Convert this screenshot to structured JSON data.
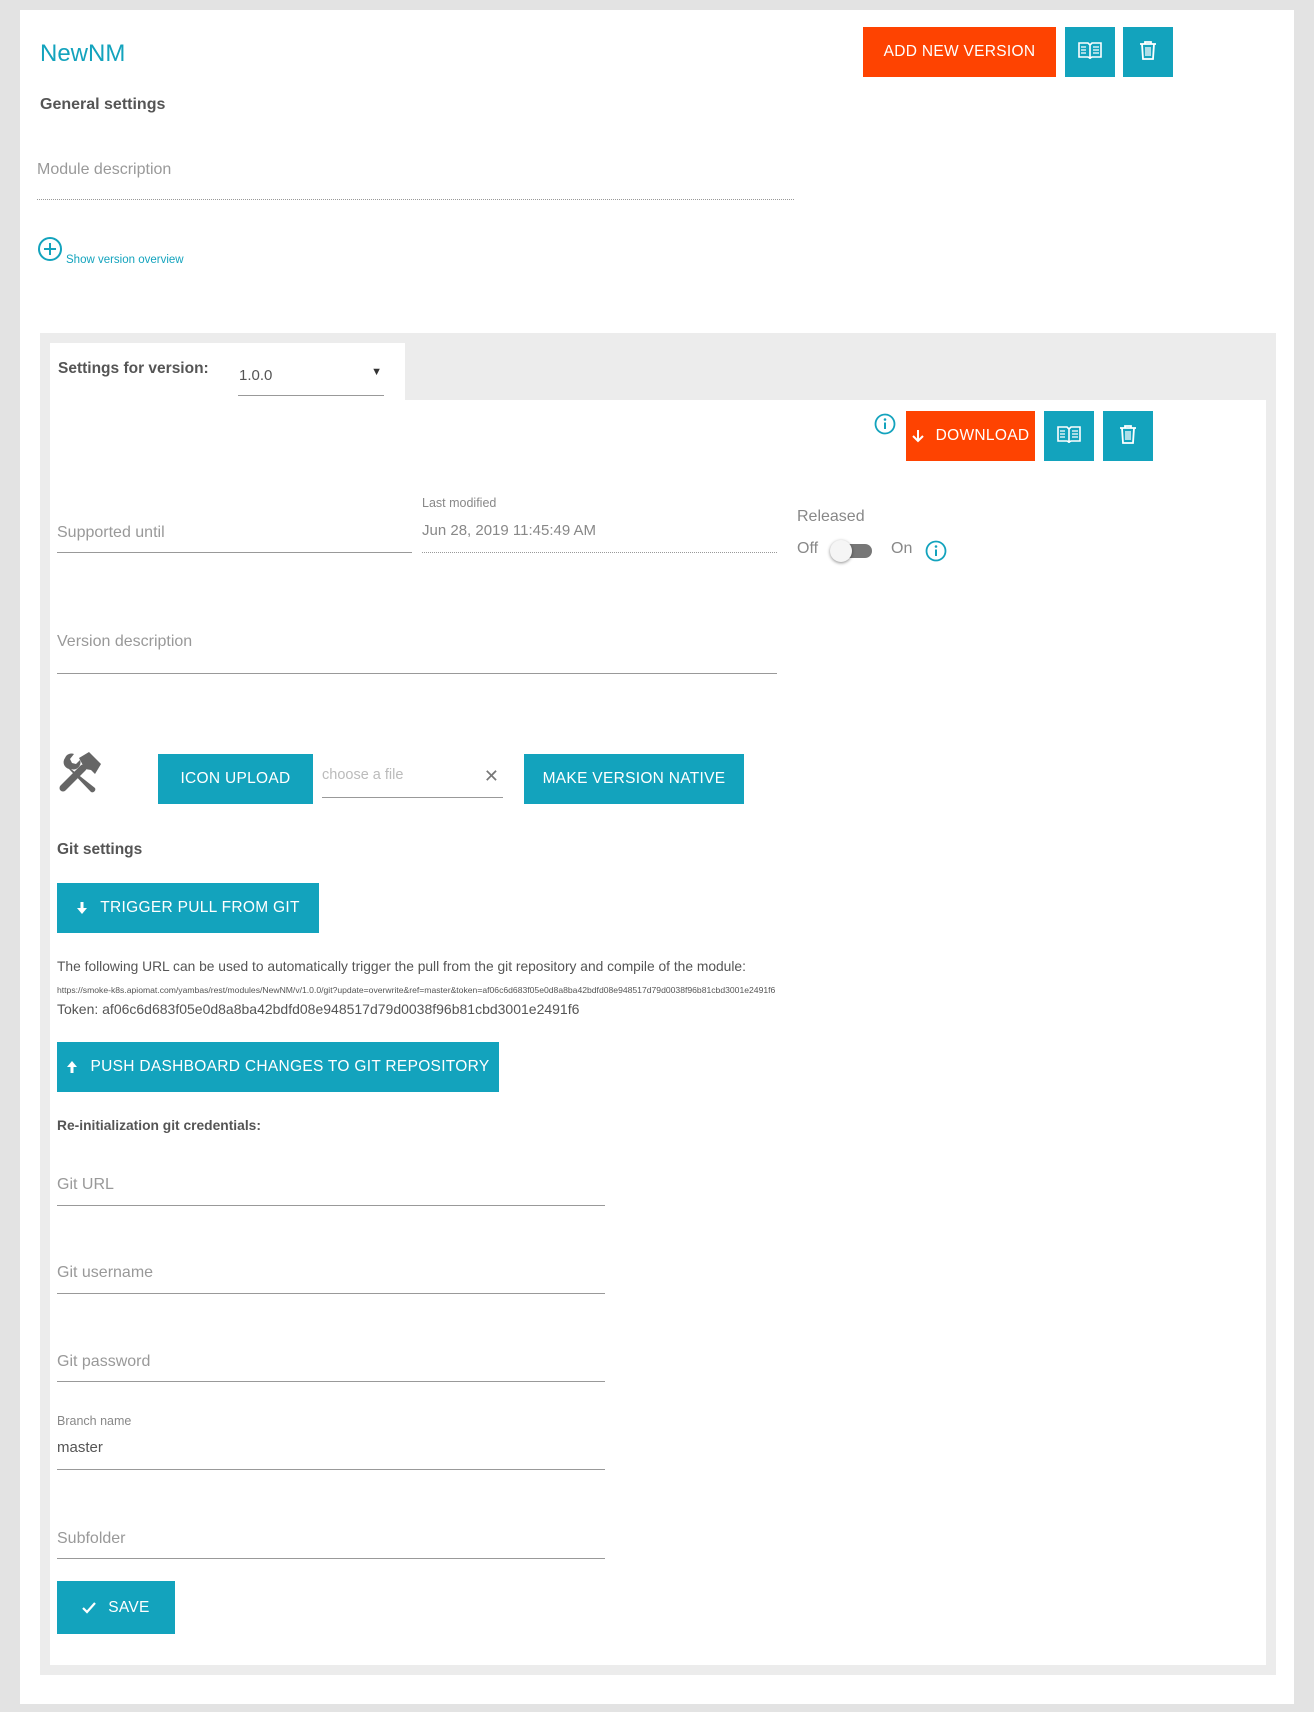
{
  "module": {
    "title": "NewNM",
    "general_settings_label": "General settings",
    "description_placeholder": "Module description",
    "show_version_overview": "Show version overview"
  },
  "header_actions": {
    "add_new_version": "ADD NEW VERSION",
    "docs_icon": "book-icon",
    "delete_icon": "trash-icon"
  },
  "version": {
    "settings_label": "Settings for version:",
    "selected": "1.0.0",
    "download": "DOWNLOAD",
    "supported_until_placeholder": "Supported until",
    "last_modified_label": "Last modified",
    "last_modified_value": "Jun 28, 2019 11:45:49 AM",
    "released_label": "Released",
    "released_off": "Off",
    "released_on": "On",
    "released": false,
    "version_description_placeholder": "Version description",
    "icon_upload": "ICON UPLOAD",
    "choose_file_placeholder": "choose a file",
    "make_native": "MAKE VERSION NATIVE"
  },
  "git": {
    "section_label": "Git settings",
    "trigger_pull": "TRIGGER PULL FROM GIT",
    "url_info": "The following URL can be used to automatically trigger the pull from the git repository and compile of the module:",
    "trigger_url": "https://smoke-k8s.apiomat.com/yambas/rest/modules/NewNM/v/1.0.0/git?update=overwrite&ref=master&token=af06c6d683f05e0d8a8ba42bdfd08e948517d79d0038f96b81cbd3001e2491f6",
    "token": "Token: af06c6d683f05e0d8a8ba42bdfd08e948517d79d0038f96b81cbd3001e2491f6",
    "push_changes": "PUSH DASHBOARD CHANGES TO GIT REPOSITORY",
    "reinit_label": "Re-initialization git credentials:",
    "git_url_placeholder": "Git URL",
    "git_username_placeholder": "Git username",
    "git_password_placeholder": "Git password",
    "branch_label": "Branch name",
    "branch_value": "master",
    "subfolder_placeholder": "Subfolder",
    "save": "SAVE"
  },
  "colors": {
    "accent": "#13a3bd",
    "primary_action": "#fe4301"
  }
}
